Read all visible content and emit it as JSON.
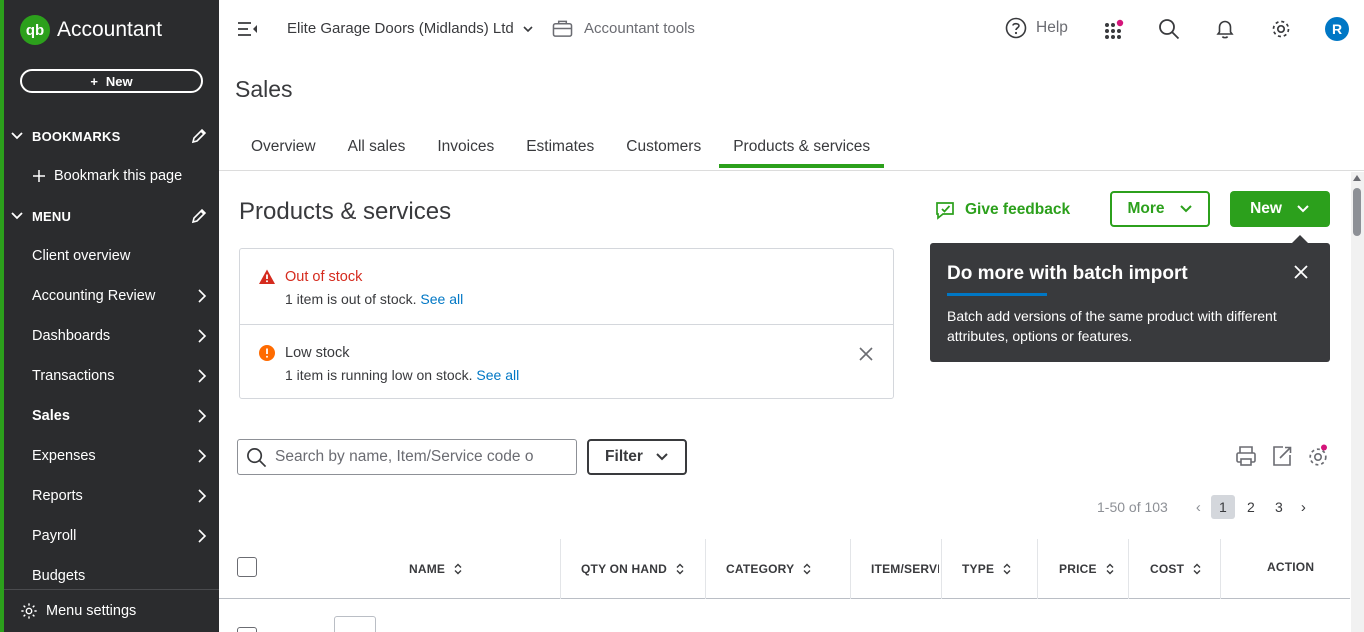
{
  "sidebar": {
    "brand": "Accountant",
    "logo_text": "qb",
    "new_label": "New",
    "bookmarks_heading": "BOOKMARKS",
    "bookmark_this_page": "Bookmark this page",
    "menu_heading": "MENU",
    "items": [
      {
        "label": "Client overview",
        "has_arrow": false
      },
      {
        "label": "Accounting Review",
        "has_arrow": true
      },
      {
        "label": "Dashboards",
        "has_arrow": true
      },
      {
        "label": "Transactions",
        "has_arrow": true
      },
      {
        "label": "Sales",
        "has_arrow": true,
        "active": true
      },
      {
        "label": "Expenses",
        "has_arrow": true
      },
      {
        "label": "Reports",
        "has_arrow": true
      },
      {
        "label": "Payroll",
        "has_arrow": true
      },
      {
        "label": "Budgets",
        "has_arrow": false
      }
    ],
    "menu_settings": "Menu settings"
  },
  "topbar": {
    "company": "Elite Garage Doors (Midlands) Ltd",
    "accountant_tools": "Accountant tools",
    "help": "Help",
    "avatar_initial": "R"
  },
  "page": {
    "title": "Sales",
    "tabs": [
      "Overview",
      "All sales",
      "Invoices",
      "Estimates",
      "Customers",
      "Products & services"
    ],
    "active_tab": "Products & services"
  },
  "content": {
    "heading": "Products & services",
    "give_feedback": "Give feedback",
    "more_label": "More",
    "new_label": "New",
    "alerts": {
      "out_of_stock": {
        "title": "Out of stock",
        "message": "1 item is out of stock.",
        "link": "See all"
      },
      "low_stock": {
        "title": "Low stock",
        "message": "1 item is running low on stock.",
        "link": "See all"
      }
    },
    "popover": {
      "title": "Do more with batch import",
      "body": "Batch add versions of the same product with different attributes, options or features."
    },
    "search_placeholder": "Search by name, Item/Service code o",
    "filter_label": "Filter",
    "pagination": {
      "summary": "1-50 of 103",
      "pages": [
        "1",
        "2",
        "3"
      ],
      "current": "1"
    },
    "table": {
      "columns": [
        "NAME",
        "QTY ON HAND",
        "CATEGORY",
        "ITEM/SERVI",
        "TYPE",
        "PRICE",
        "COST",
        "ACTION"
      ]
    }
  },
  "colors": {
    "brand_green": "#2ca01c",
    "sidebar_bg": "#2b2c2e",
    "link_blue": "#0077c5",
    "error_red": "#d52b1e",
    "warning_orange": "#ff6b00",
    "popover_bg": "#393a3d",
    "notification_dot": "#d4157a"
  }
}
